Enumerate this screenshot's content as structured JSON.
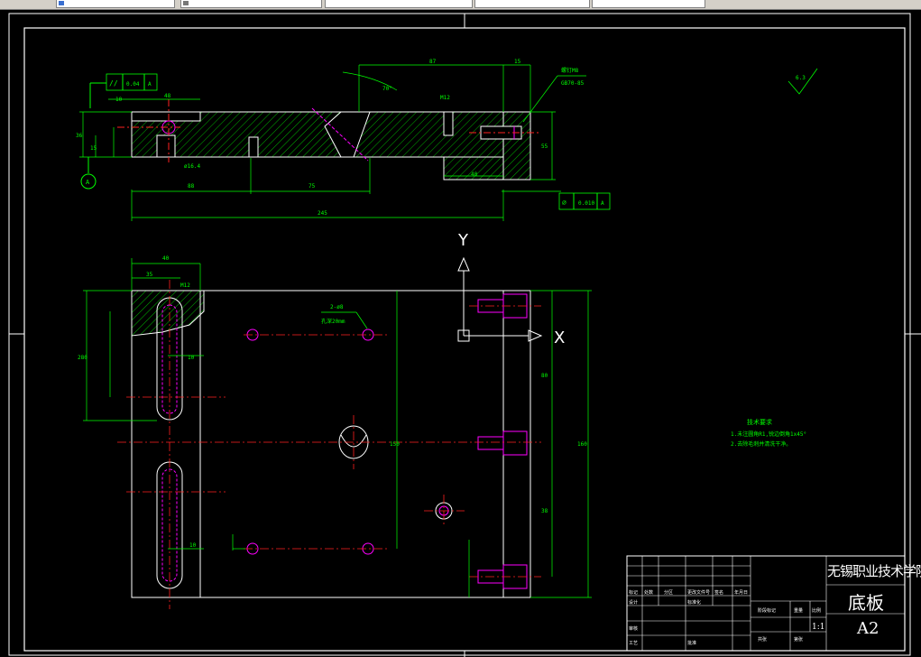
{
  "window": {
    "tabs": [
      "",
      "",
      "",
      "",
      "",
      "",
      ""
    ]
  },
  "drawing": {
    "axis_y": "Y",
    "axis_x": "X",
    "roughness_top": "6.3",
    "dims_top": {
      "d87": "87",
      "d15": "15",
      "d245": "245",
      "d88": "88",
      "d75": "75",
      "d40": "40",
      "d48": "48",
      "d36": "36",
      "d15b": "15",
      "d10": "10",
      "d55": "55",
      "m12": "M12",
      "phi16": "ø16.4",
      "angle": "70°"
    },
    "tol_top": {
      "sym": "//",
      "val": "0.04",
      "ref": "A"
    },
    "tol_bottom": {
      "sym": "⌀",
      "val": "0.010",
      "ref": "A"
    },
    "datum": "A",
    "screw_label": [
      "螺钉M8",
      "GB70-85"
    ],
    "plan_dims": {
      "d40": "40",
      "d35": "35",
      "m12": "M12",
      "hole_label": "2-ø8",
      "hole_note": "孔深20mm",
      "d10": "10",
      "d10b": "10",
      "d280": "280",
      "d150": "150",
      "d160": "160",
      "d80": "80",
      "d38": "38"
    },
    "tech_req": {
      "title": "技术要求",
      "lines": [
        "1.未注圆角R1,锐边倒角1x45°",
        "2.去除毛刺并清洗干净。"
      ]
    }
  },
  "title_block": {
    "school": "无锡职业技术学院",
    "part_name": "底板",
    "sheet": "A2",
    "scale": "1:1",
    "rows": [
      "标记",
      "处数",
      "分区",
      "更改文件号",
      "签名",
      "年月日",
      "设计",
      "标准化",
      "审核",
      "工艺",
      "批准",
      "阶段标记",
      "重量",
      "比例",
      "共张",
      "第张"
    ]
  },
  "colors": {
    "frame": "#ffffff",
    "dimension": "#00ff00",
    "hatch": "#00ff00",
    "centerline": "#ff2020",
    "hidden": "#ff00ff",
    "tbtext": "#ffffff"
  }
}
